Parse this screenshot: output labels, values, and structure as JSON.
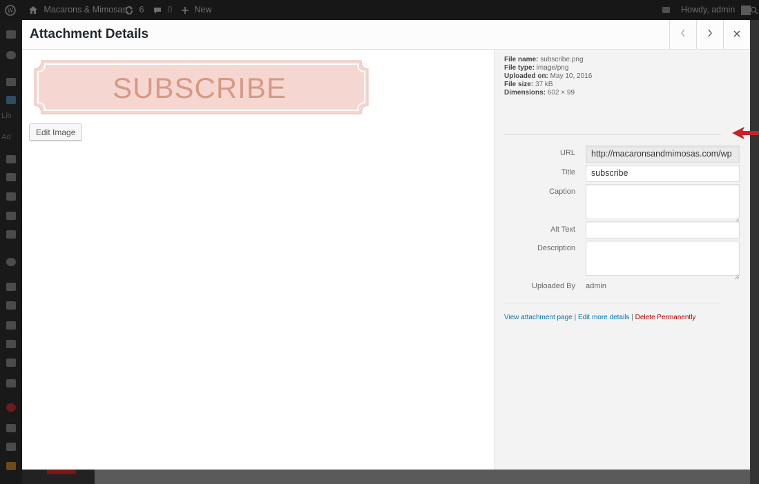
{
  "adminbar": {
    "site_name": "Macarons & Mimosas",
    "updates_count": "6",
    "comments_count": "0",
    "new_label": "New",
    "howdy": "Howdy, admin"
  },
  "sidemenu": {
    "library_label": "Lib",
    "add_label": "Ad"
  },
  "modal": {
    "title": "Attachment Details",
    "edit_image_label": "Edit Image",
    "preview_text": "SUBSCRIBE",
    "details": {
      "file_name_label": "File name:",
      "file_name": "subscribe.png",
      "file_type_label": "File type:",
      "file_type": "image/png",
      "uploaded_on_label": "Uploaded on:",
      "uploaded_on": "May 10, 2016",
      "file_size_label": "File size:",
      "file_size": "37 kB",
      "dimensions_label": "Dimensions:",
      "dimensions": "602 × 99"
    },
    "fields": {
      "url_label": "URL",
      "url_value": "http://macaronsandmimosas.com/wp",
      "title_label": "Title",
      "title_value": "subscribe",
      "caption_label": "Caption",
      "caption_value": "",
      "alt_label": "Alt Text",
      "alt_value": "",
      "description_label": "Description",
      "description_value": "",
      "uploaded_by_label": "Uploaded By",
      "uploaded_by_value": "admin"
    },
    "actions": {
      "view_page": "View attachment page",
      "edit_more": "Edit more details",
      "delete": "Delete Permanently",
      "separator": "|"
    }
  },
  "colors": {
    "accent_link": "#0073aa",
    "delete_red": "#aa0000",
    "preview_pink": "#f6d6d0",
    "preview_text": "#d59a86",
    "annotation_arrow": "#cc1f26"
  }
}
